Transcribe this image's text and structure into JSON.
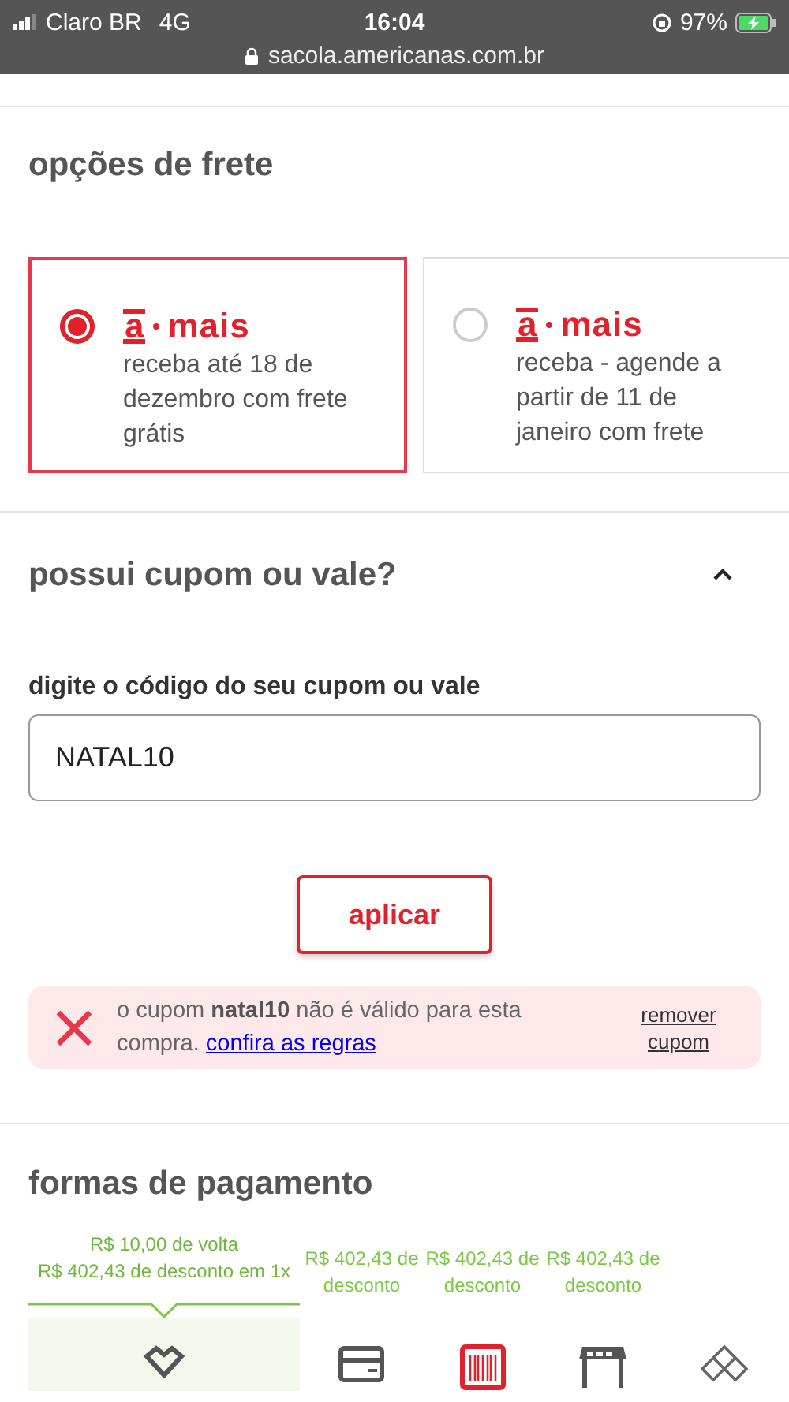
{
  "status_bar": {
    "carrier": "Claro BR",
    "network": "4G",
    "time": "16:04",
    "battery": "97%",
    "url": "sacola.americanas.com.br"
  },
  "shipping": {
    "title": "opções de frete",
    "options": [
      {
        "brand_a": "a",
        "brand_rest": "mais",
        "text": "receba até 18 de dezembro com frete grátis",
        "selected": true
      },
      {
        "brand_a": "a",
        "brand_rest": "mais",
        "text": "receba - agende a partir de 11 de janeiro com frete",
        "selected": false
      }
    ]
  },
  "coupon": {
    "title": "possui cupom ou vale?",
    "expanded": true,
    "label": "digite o código do seu cupom ou vale",
    "value": "NATAL10",
    "apply": "aplicar",
    "error": {
      "message": "o cupom **natal10** não é válido para esta compra.",
      "link": "confira as regras",
      "remove": "remover cupom"
    }
  },
  "payment": {
    "title": "formas de pagamento",
    "tabs": [
      {
        "lines": [
          "R$ 10,00 de volta",
          "R$ 402,43 de desconto em 1x"
        ],
        "kind": "gift",
        "selected": true
      },
      {
        "lines": [
          "R$ 402,43 de",
          "desconto"
        ],
        "kind": "card",
        "selected": false
      },
      {
        "lines": [
          "R$ 402,43 de",
          "desconto"
        ],
        "kind": "barcode",
        "selected": false
      },
      {
        "lines": [
          "R$ 402,43 de",
          "desconto"
        ],
        "kind": "store",
        "selected": false
      },
      {
        "kind": "diamond",
        "selected": false
      }
    ]
  }
}
